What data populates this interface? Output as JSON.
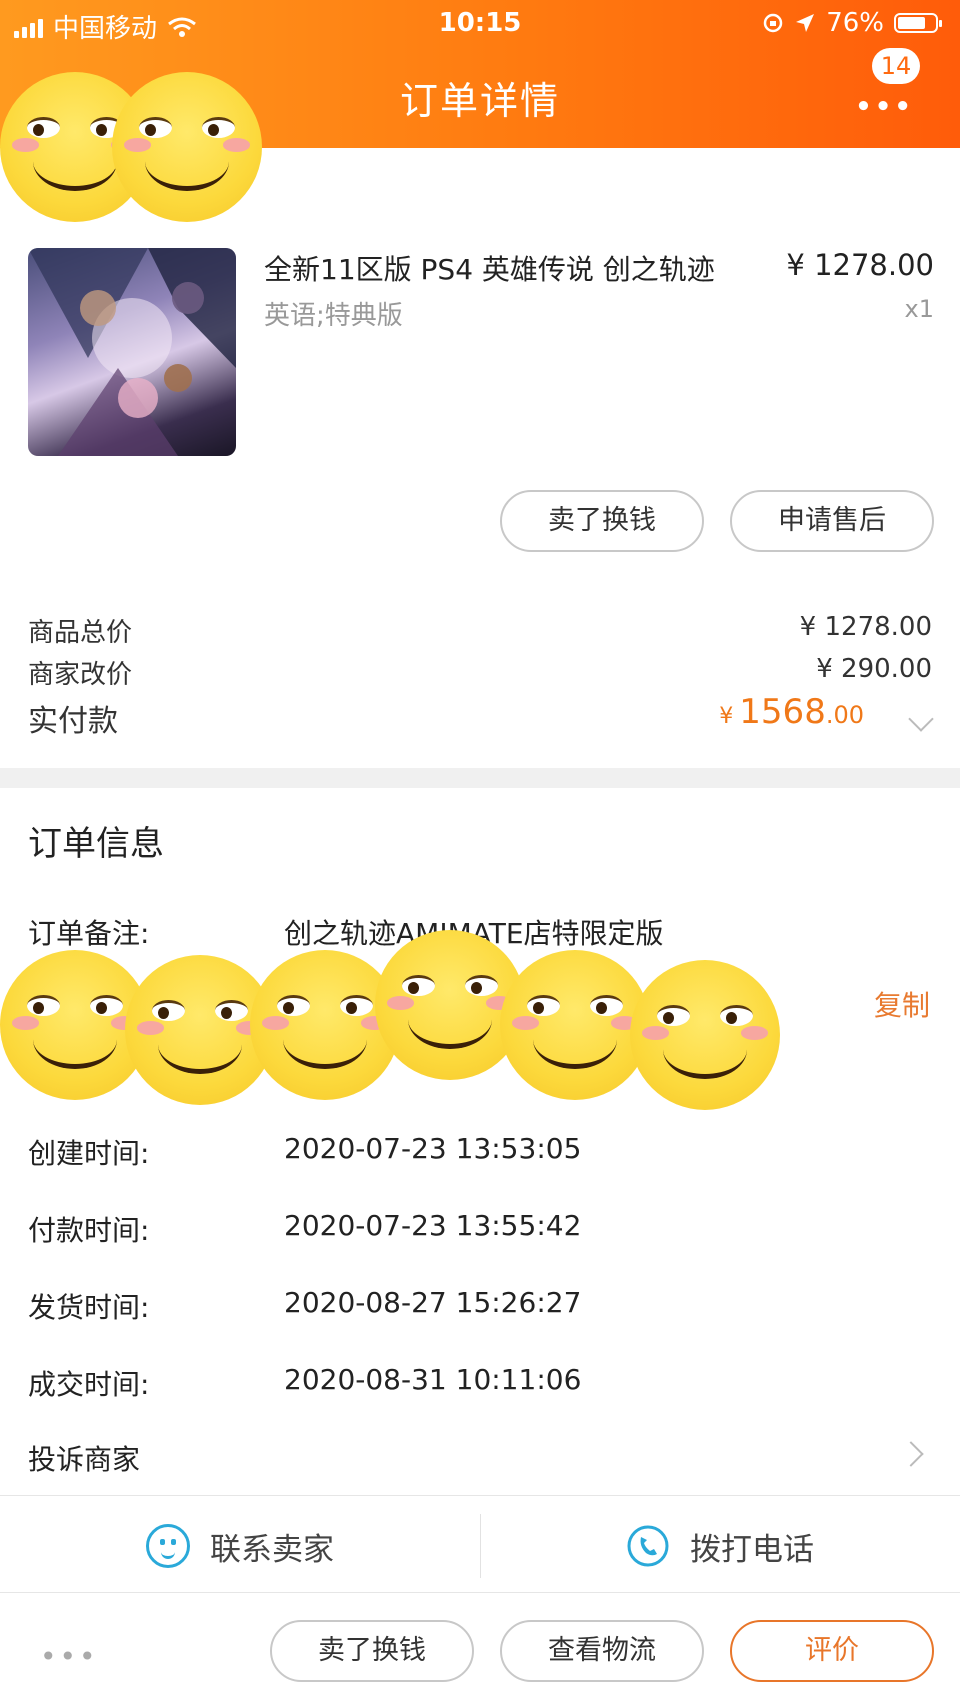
{
  "status_bar": {
    "carrier": "中国移动",
    "time": "10:15",
    "battery": "76%",
    "battery_level": 0.76
  },
  "header": {
    "title": "订单详情",
    "badge_count": "14"
  },
  "product": {
    "name": "全新11区版 PS4 英雄传说 创之轨迹",
    "price": "¥ 1278.00",
    "sku": "英语;特典版",
    "quantity": "x1"
  },
  "item_actions": {
    "sell_label": "卖了换钱",
    "aftersale_label": "申请售后"
  },
  "price_summary": {
    "total_label": "商品总价",
    "total_value": "¥ 1278.00",
    "adjust_label": "商家改价",
    "adjust_value": "¥ 290.00",
    "paid_label": "实付款",
    "paid_currency": "¥",
    "paid_integer": "1568",
    "paid_decimal": ".00"
  },
  "order_info": {
    "title": "订单信息",
    "note_label": "订单备注:",
    "note_value": "创之轨迹AMIMATE店特限定版",
    "copy_label": "复制",
    "rows": [
      {
        "label": "创建时间:",
        "value": "2020-07-23 13:53:05"
      },
      {
        "label": "付款时间:",
        "value": "2020-07-23 13:55:42"
      },
      {
        "label": "发货时间:",
        "value": "2020-08-27 15:26:27"
      },
      {
        "label": "成交时间:",
        "value": "2020-08-31 10:11:06"
      }
    ],
    "complain_label": "投诉商家"
  },
  "contact": {
    "seller_label": "联系卖家",
    "call_label": "拨打电话"
  },
  "bottom_bar": {
    "more_label": "•••",
    "sell_label": "卖了换钱",
    "logistics_label": "查看物流",
    "review_label": "评价"
  },
  "colors": {
    "header_start": "#ff9a1f",
    "header_end": "#ff5c0a",
    "accent": "#f07818",
    "contact_icon": "#2aa9d9"
  }
}
